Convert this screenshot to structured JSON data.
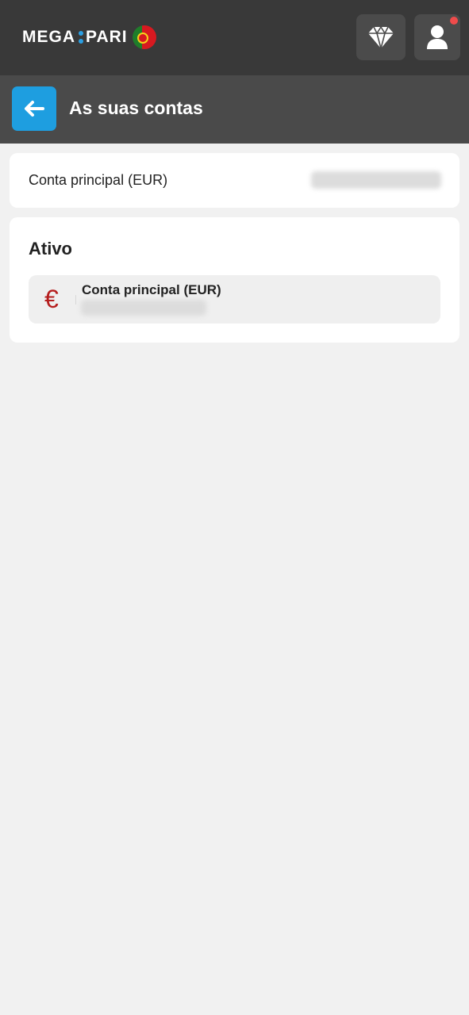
{
  "header": {
    "logo_left": "MEGA",
    "logo_right": "PARI",
    "notification": true
  },
  "subheader": {
    "title": "As suas contas"
  },
  "main_account": {
    "label": "Conta principal (EUR)"
  },
  "active_section": {
    "title": "Ativo",
    "accounts": [
      {
        "currency_symbol": "€",
        "name": "Conta principal (EUR)"
      }
    ]
  },
  "colors": {
    "header_bg": "#393939",
    "subheader_bg": "#4a4a4a",
    "accent_blue": "#1e9ee0",
    "euro_red": "#b51e1e",
    "notification_red": "#ef4b4b"
  }
}
